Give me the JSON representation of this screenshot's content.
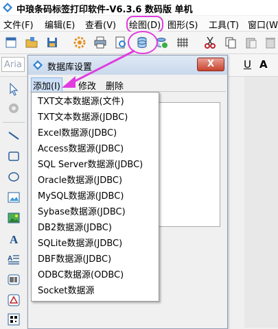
{
  "window": {
    "title": "中琅条码标签打印软件-V6.3.6 数码版 单机"
  },
  "menu": [
    {
      "label": "文件(F)"
    },
    {
      "label": "编辑(E)"
    },
    {
      "label": "查看(V)"
    },
    {
      "label": "绘图(D)"
    },
    {
      "label": "图形(S)"
    },
    {
      "label": "工具(T)"
    },
    {
      "label": "窗口(W)"
    }
  ],
  "formatbar": {
    "font_value": "Aria",
    "underline": "U",
    "font_color": "A"
  },
  "dialog": {
    "title": "数据库设置",
    "close_label": "X",
    "menu": [
      {
        "label": "添加(I)"
      },
      {
        "label": "修改"
      },
      {
        "label": "删除"
      }
    ]
  },
  "dropdown": {
    "items": [
      "TXT文本数据源(文件)",
      "TXT文本数据源(JDBC)",
      "Excel数据源(JDBC)",
      "Access数据源(JDBC)",
      "SQL Server数据源(JDBC)",
      "Oracle数据源(JDBC)",
      "MySQL数据源(JDBC)",
      "Sybase数据源(JDBC)",
      "DB2数据源(JDBC)",
      "SQLite数据源(JDBC)",
      "DBF数据源(JDBC)",
      "ODBC数据源(ODBC)",
      "Socket数据源"
    ]
  },
  "colors": {
    "highlight": "#e03ce0",
    "accent": "#2a7fd4"
  }
}
